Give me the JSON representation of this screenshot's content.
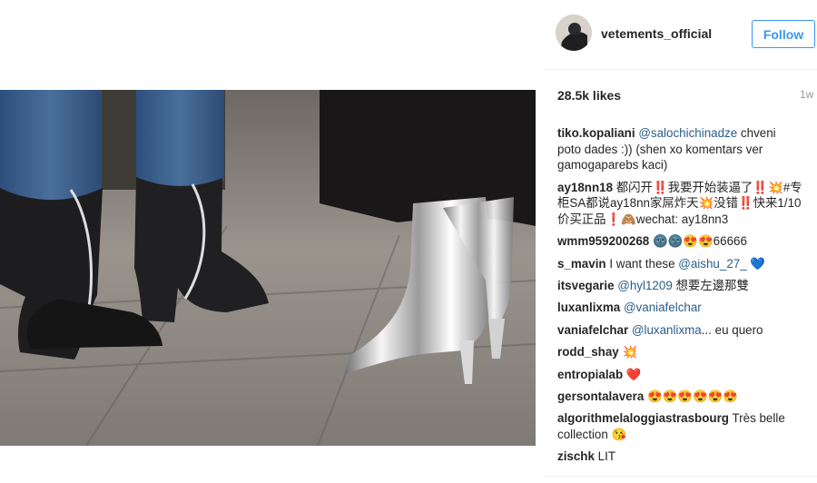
{
  "post": {
    "username": "vetements_official",
    "follow_label": "Follow",
    "likes": "28.5k likes",
    "time": "1w"
  },
  "comments": [
    {
      "user": "tiko.kopaliani",
      "mention": "@salochichinadze",
      "text": " chveni poto dades :)) (shen xo komentars ver gamogaparebs kaci)"
    },
    {
      "user": "ay18nn18",
      "text": " 都闪开‼️我要开始装逼了‼️💥#专柜SA都说ay18nn家屌炸天💥没错‼️快来1/10价买正品❗️🙈wechat: ay18nn3"
    },
    {
      "user": "wmm959200268",
      "text": " 🌚🌚😍😍66666"
    },
    {
      "user": "s_mavin",
      "text": " I want these ",
      "mention": "@aishu_27_",
      "suffix": " 💙"
    },
    {
      "user": "itsvegarie",
      "mention": "@hyl1209",
      "text": " 想要左邊那雙"
    },
    {
      "user": "luxanlixma",
      "mention": "@vaniafelchar",
      "text": ""
    },
    {
      "user": "vaniafelchar",
      "mention": "@luxanlixma",
      "text": "... eu quero"
    },
    {
      "user": "rodd_shay",
      "text": " 💥"
    },
    {
      "user": "entropialab",
      "text": " ❤️"
    },
    {
      "user": "gersontalavera",
      "text": " 😍😍😍😍😍😍"
    },
    {
      "user": "algorithmelaloggiastrasbourg",
      "text": " Très belle collection 😘"
    },
    {
      "user": "zischk",
      "text": " LIT"
    }
  ]
}
